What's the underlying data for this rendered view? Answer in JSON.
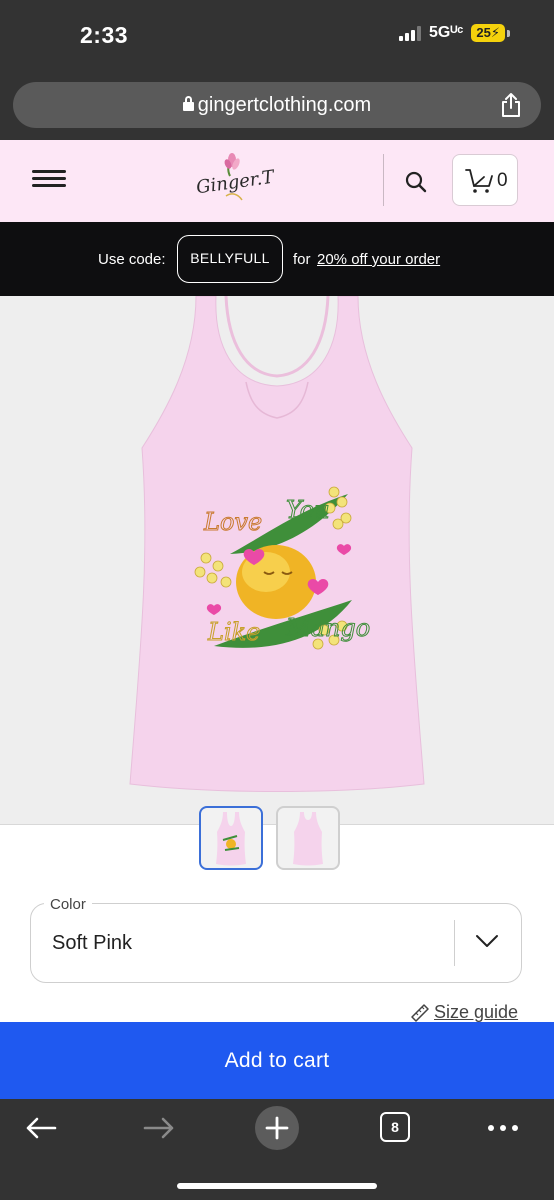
{
  "status_bar": {
    "time": "2:33",
    "network": "5Gᵁᶜ",
    "battery": "25"
  },
  "browser": {
    "url": "gingertclothing.com",
    "open_tabs": "8"
  },
  "header": {
    "logo_text": "Ginger.T",
    "cart_count": "0"
  },
  "promo": {
    "prefix": "Use code:",
    "code": "BELLYFULL",
    "middle": "for",
    "link": "20% off your order"
  },
  "product": {
    "design_text": [
      "Love",
      "You",
      "Like",
      "Mango"
    ],
    "thumbnails": [
      "front-view",
      "back-view"
    ],
    "color": {
      "legend": "Color",
      "value": "Soft Pink"
    },
    "size_guide": "Size guide",
    "add_to_cart": "Add to cart"
  },
  "colors": {
    "accent": "#1f59f0",
    "header_bg": "#fde7f6",
    "promo_bg": "#0e0e10",
    "shirt": "#f5d3ec",
    "chrome": "#333333"
  }
}
